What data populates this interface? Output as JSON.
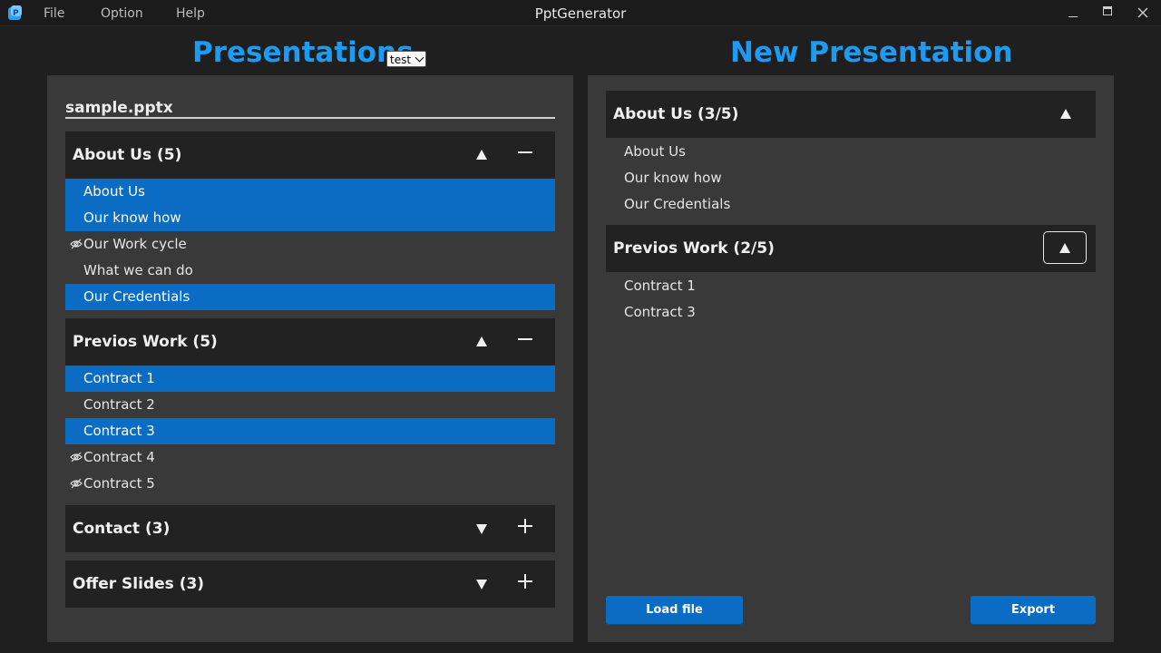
{
  "window": {
    "title": "PptGenerator",
    "menu": [
      "File",
      "Option",
      "Help"
    ],
    "controls": {
      "minimize": "—",
      "maximize": "☐",
      "close": "✕"
    }
  },
  "left": {
    "heading": "Presentations",
    "selector_value": "test",
    "file_name": "sample.pptx",
    "sections": [
      {
        "title": "About Us (5)",
        "expanded": true,
        "items": [
          {
            "label": "About Us",
            "selected": true,
            "hidden": false
          },
          {
            "label": "Our know how",
            "selected": true,
            "hidden": false
          },
          {
            "label": "Our Work cycle",
            "selected": false,
            "hidden": true
          },
          {
            "label": "What we can do",
            "selected": false,
            "hidden": false
          },
          {
            "label": "Our Credentials",
            "selected": true,
            "hidden": false
          }
        ]
      },
      {
        "title": "Previos Work (5)",
        "expanded": true,
        "items": [
          {
            "label": "Contract 1",
            "selected": true,
            "hidden": false
          },
          {
            "label": "Contract 2",
            "selected": false,
            "hidden": false
          },
          {
            "label": "Contract 3",
            "selected": true,
            "hidden": false
          },
          {
            "label": "Contract 4",
            "selected": false,
            "hidden": true
          },
          {
            "label": "Contract 5",
            "selected": false,
            "hidden": true
          }
        ]
      },
      {
        "title": "Contact (3)",
        "expanded": false,
        "items": []
      },
      {
        "title": "Offer Slides (3)",
        "expanded": false,
        "items": []
      }
    ]
  },
  "right": {
    "heading": "New Presentation",
    "sections": [
      {
        "title": "About Us (3/5)",
        "items": [
          "About Us",
          "Our know how",
          "Our Credentials"
        ]
      },
      {
        "title": "Previos Work (2/5)",
        "items": [
          "Contract 1",
          "Contract 3"
        ]
      }
    ],
    "load_label": "Load file",
    "export_label": "Export"
  },
  "colors": {
    "accent": "#1e9bf0",
    "selection": "#0b6cc3",
    "panel": "#393939",
    "section_header": "#222222",
    "background": "#1f1f1f"
  }
}
